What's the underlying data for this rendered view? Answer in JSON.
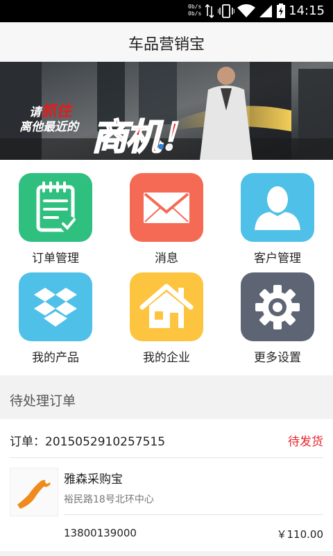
{
  "status_bar": {
    "net_up": "0b/s",
    "net_down": "0b/s",
    "time": "14:15"
  },
  "header": {
    "title": "车品营销宝"
  },
  "banner": {
    "text_prefix": "请",
    "text_highlight": "抓住",
    "text_line2": "离他最近的",
    "text_big": "商机！"
  },
  "menu": {
    "items": [
      {
        "label": "订单管理",
        "icon": "clipboard-icon",
        "color": "#2fbf7e"
      },
      {
        "label": "消息",
        "icon": "envelope-icon",
        "color": "#f46a55"
      },
      {
        "label": "客户管理",
        "icon": "person-icon",
        "color": "#4fc0e8"
      },
      {
        "label": "我的产品",
        "icon": "box-icon",
        "color": "#4fc0e8"
      },
      {
        "label": "我的企业",
        "icon": "house-icon",
        "color": "#fdc43f"
      },
      {
        "label": "更多设置",
        "icon": "gear-icon",
        "color": "#5d6473"
      }
    ]
  },
  "pending": {
    "section_title": "待处理订单",
    "order": {
      "label": "订单：",
      "number": "2015052910257515",
      "status": "待发货",
      "shop": "雅森采购宝",
      "address": "裕民路18号北环中心",
      "phone": "13800139000",
      "price": "￥110.00"
    }
  },
  "colors": {
    "status_red": "#e8242a",
    "dot_active": "#2a7fd6"
  }
}
